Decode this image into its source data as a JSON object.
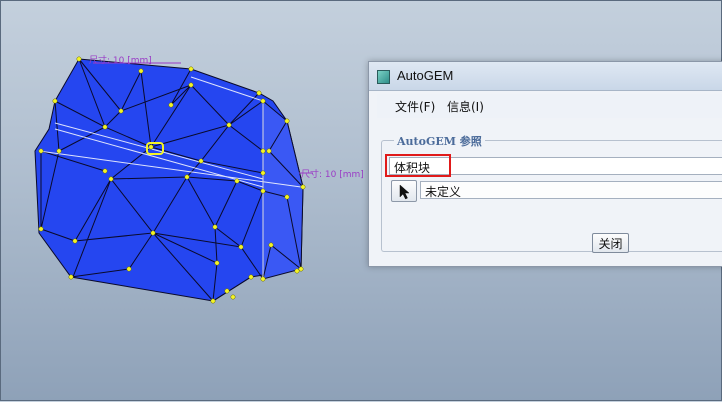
{
  "window": {
    "title": "AutoGEM",
    "icon": "autogem-app-icon"
  },
  "menu": {
    "items": [
      {
        "label": "文件(F)"
      },
      {
        "label": "信息(I)"
      }
    ]
  },
  "references": {
    "group_label": "AutoGEM 参照",
    "input_value": "体积块",
    "select_icon": "pointer-arrow-icon",
    "selection_value": "未定义"
  },
  "actions": {
    "close_label": "关闭"
  },
  "model": {
    "dimension_labels": [
      "尺寸: 10 [mm]",
      "尺寸: 10 [mm]"
    ],
    "mesh_color": "#2546f0",
    "edge_color": "#0a0a2a",
    "node_color": "#f4f426",
    "highlight_color": "#e01a1a"
  }
}
